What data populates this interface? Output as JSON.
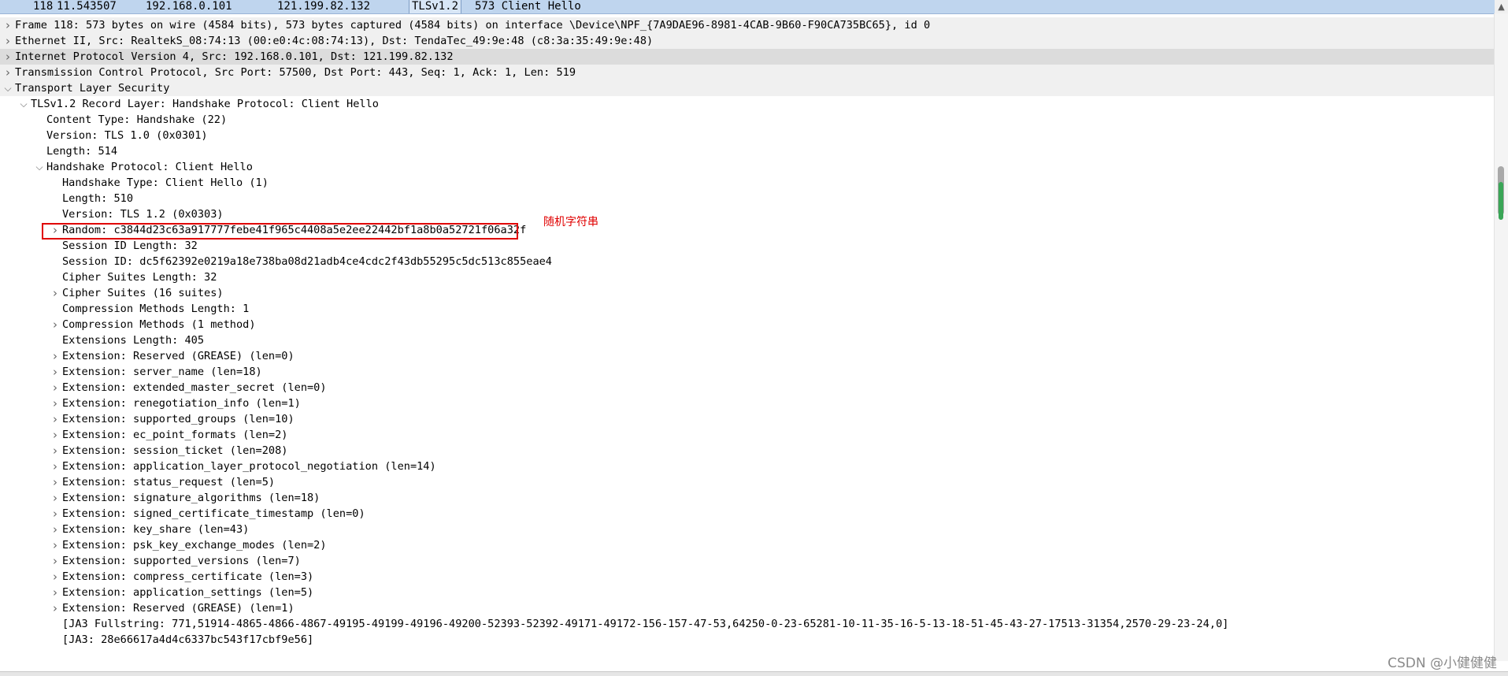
{
  "packet_list_row": {
    "number": "118",
    "time": "11.543507",
    "source": "192.168.0.101",
    "destination": "121.199.82.132",
    "protocol": "TLSv1.2",
    "info": "573 Client Hello"
  },
  "tree": [
    {
      "text": "Frame 118: 573 bytes on wire (4584 bits), 573 bytes captured (4584 bits) on interface \\Device\\NPF_{7A9DAE96-8981-4CAB-9B60-F90CA735BC65}, id 0",
      "level": 0,
      "arrow": "collapsed"
    },
    {
      "text": "Ethernet II, Src: RealtekS_08:74:13 (00:e0:4c:08:74:13), Dst: TendaTec_49:9e:48 (c8:3a:35:49:9e:48)",
      "level": 0,
      "arrow": "collapsed"
    },
    {
      "text": "Internet Protocol Version 4, Src: 192.168.0.101, Dst: 121.199.82.132",
      "level": 0,
      "arrow": "collapsed",
      "selected": true
    },
    {
      "text": "Transmission Control Protocol, Src Port: 57500, Dst Port: 443, Seq: 1, Ack: 1, Len: 519",
      "level": 0,
      "arrow": "collapsed"
    },
    {
      "text": "Transport Layer Security",
      "level": 0,
      "arrow": "expanded"
    },
    {
      "text": "TLSv1.2 Record Layer: Handshake Protocol: Client Hello",
      "level": 1,
      "arrow": "expanded"
    },
    {
      "text": "Content Type: Handshake (22)",
      "level": 2,
      "arrow": "none"
    },
    {
      "text": "Version: TLS 1.0 (0x0301)",
      "level": 2,
      "arrow": "none"
    },
    {
      "text": "Length: 514",
      "level": 2,
      "arrow": "none"
    },
    {
      "text": "Handshake Protocol: Client Hello",
      "level": 2,
      "arrow": "expanded"
    },
    {
      "text": "Handshake Type: Client Hello (1)",
      "level": 3,
      "arrow": "none"
    },
    {
      "text": "Length: 510",
      "level": 3,
      "arrow": "none"
    },
    {
      "text": "Version: TLS 1.2 (0x0303)",
      "level": 3,
      "arrow": "none"
    },
    {
      "text": "Random: c3844d23c63a917777febe41f965c4408a5e2ee22442bf1a8b0a52721f06a32f",
      "level": 3,
      "arrow": "collapsed",
      "highlighted": true
    },
    {
      "text": "Session ID Length: 32",
      "level": 3,
      "arrow": "none"
    },
    {
      "text": "Session ID: dc5f62392e0219a18e738ba08d21adb4ce4cdc2f43db55295c5dc513c855eae4",
      "level": 3,
      "arrow": "none"
    },
    {
      "text": "Cipher Suites Length: 32",
      "level": 3,
      "arrow": "none"
    },
    {
      "text": "Cipher Suites (16 suites)",
      "level": 3,
      "arrow": "collapsed"
    },
    {
      "text": "Compression Methods Length: 1",
      "level": 3,
      "arrow": "none"
    },
    {
      "text": "Compression Methods (1 method)",
      "level": 3,
      "arrow": "collapsed"
    },
    {
      "text": "Extensions Length: 405",
      "level": 3,
      "arrow": "none"
    },
    {
      "text": "Extension: Reserved (GREASE) (len=0)",
      "level": 3,
      "arrow": "collapsed"
    },
    {
      "text": "Extension: server_name (len=18)",
      "level": 3,
      "arrow": "collapsed"
    },
    {
      "text": "Extension: extended_master_secret (len=0)",
      "level": 3,
      "arrow": "collapsed"
    },
    {
      "text": "Extension: renegotiation_info (len=1)",
      "level": 3,
      "arrow": "collapsed"
    },
    {
      "text": "Extension: supported_groups (len=10)",
      "level": 3,
      "arrow": "collapsed"
    },
    {
      "text": "Extension: ec_point_formats (len=2)",
      "level": 3,
      "arrow": "collapsed"
    },
    {
      "text": "Extension: session_ticket (len=208)",
      "level": 3,
      "arrow": "collapsed"
    },
    {
      "text": "Extension: application_layer_protocol_negotiation (len=14)",
      "level": 3,
      "arrow": "collapsed"
    },
    {
      "text": "Extension: status_request (len=5)",
      "level": 3,
      "arrow": "collapsed"
    },
    {
      "text": "Extension: signature_algorithms (len=18)",
      "level": 3,
      "arrow": "collapsed"
    },
    {
      "text": "Extension: signed_certificate_timestamp (len=0)",
      "level": 3,
      "arrow": "collapsed"
    },
    {
      "text": "Extension: key_share (len=43)",
      "level": 3,
      "arrow": "collapsed"
    },
    {
      "text": "Extension: psk_key_exchange_modes (len=2)",
      "level": 3,
      "arrow": "collapsed"
    },
    {
      "text": "Extension: supported_versions (len=7)",
      "level": 3,
      "arrow": "collapsed"
    },
    {
      "text": "Extension: compress_certificate (len=3)",
      "level": 3,
      "arrow": "collapsed"
    },
    {
      "text": "Extension: application_settings (len=5)",
      "level": 3,
      "arrow": "collapsed"
    },
    {
      "text": "Extension: Reserved (GREASE) (len=1)",
      "level": 3,
      "arrow": "collapsed"
    },
    {
      "text": "[JA3 Fullstring: 771,51914-4865-4866-4867-49195-49199-49196-49200-52393-52392-49171-49172-156-157-47-53,64250-0-23-65281-10-11-35-16-5-13-18-51-45-43-27-17513-31354,2570-29-23-24,0]",
      "level": 3,
      "arrow": "none"
    },
    {
      "text": "[JA3: 28e66617a4d4c6337bc543f17cbf9e56]",
      "level": 3,
      "arrow": "none"
    }
  ],
  "annotation": "随机字符串",
  "watermark": "CSDN @小健健健",
  "icons": {
    "collapsed": "chevron-right-icon",
    "expanded": "chevron-down-icon"
  },
  "colors": {
    "highlight_border": "#e00000",
    "packet_row_bg": "#bfd5ee",
    "selected_row_bg": "#dcdcdc",
    "scroll_marker": "#3aa657"
  }
}
